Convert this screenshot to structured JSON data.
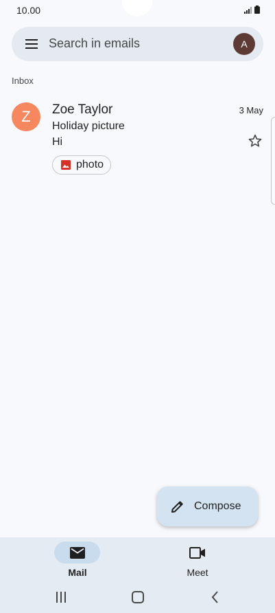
{
  "status_bar": {
    "time": "10.00",
    "icons": [
      "signal-icon",
      "battery-icon"
    ]
  },
  "search": {
    "placeholder": "Search in emails",
    "menu_icon": "hamburger-menu-icon",
    "account_initial": "A",
    "account_color": "#5d3b34"
  },
  "inbox": {
    "label": "Inbox",
    "emails": [
      {
        "avatar_letter": "Z",
        "avatar_color": "#f7875f",
        "sender": "Zoe Taylor",
        "date": "3 May",
        "subject": "Holiday picture",
        "snippet": "Hi",
        "starred": false,
        "attachment": {
          "icon": "image-icon",
          "label": "photo",
          "icon_color": "#d93025"
        }
      }
    ]
  },
  "fab": {
    "label": "Compose",
    "icon": "pencil-icon"
  },
  "bottom_nav": {
    "items": [
      {
        "label": "Mail",
        "icon": "mail-icon",
        "active": true
      },
      {
        "label": "Meet",
        "icon": "video-camera-icon",
        "active": false
      }
    ]
  },
  "system_nav": {
    "buttons": [
      "recent-apps-icon",
      "home-icon",
      "back-icon"
    ]
  }
}
